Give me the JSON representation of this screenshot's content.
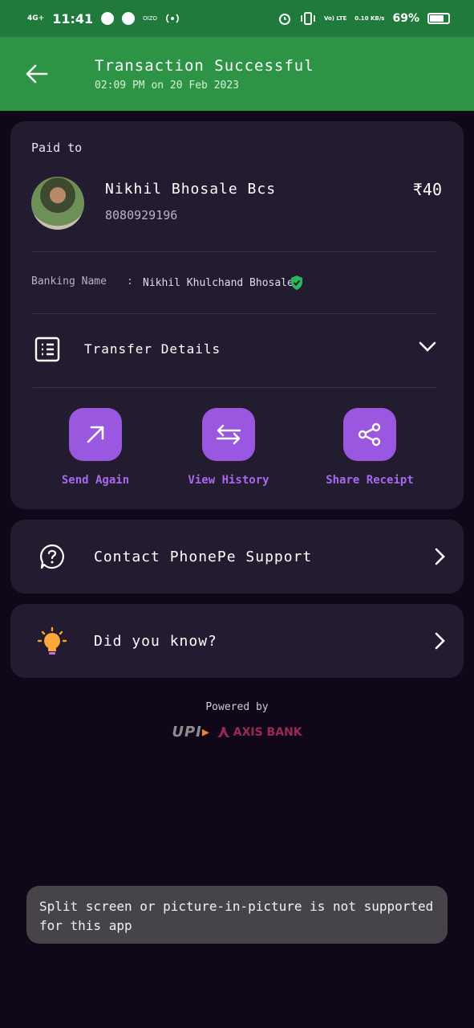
{
  "status_bar": {
    "network": "4G+",
    "time": "11:41",
    "small_label": "OIZO",
    "volte": "Vo) LTE",
    "speed": "0.10 KB/s",
    "battery": "69%",
    "battery_level": 0.69
  },
  "app_bar": {
    "title": "Transaction Successful",
    "subtitle": "02:09 PM on 20 Feb 2023"
  },
  "payment": {
    "paid_to_label": "Paid to",
    "payee_name": "Nikhil Bhosale Bcs",
    "payee_phone": "8080929196",
    "amount": "₹40",
    "banking_name_label": "Banking Name",
    "colon": ":",
    "banking_name": "Nikhil Khulchand Bhosale",
    "transfer_details_label": "Transfer Details"
  },
  "actions": [
    {
      "label": "Send Again",
      "icon": "arrow-up-right-icon"
    },
    {
      "label": "View History",
      "icon": "swap-arrows-icon"
    },
    {
      "label": "Share Receipt",
      "icon": "share-icon"
    }
  ],
  "rows": {
    "support_label": "Contact PhonePe Support",
    "did_you_know_label": "Did you know?"
  },
  "footer": {
    "powered_by": "Powered by",
    "upi_text": "UPI",
    "bank_text": "AXIS BANK"
  },
  "toast": {
    "message": "Split screen or picture-in-picture is not supported for this app"
  },
  "colors": {
    "status_bar": "#1f7a3c",
    "app_bar": "#2e9445",
    "background": "#100819",
    "card": "#231b2f",
    "accent_purple": "#9a57e0",
    "verified_green": "#2fb55a"
  }
}
